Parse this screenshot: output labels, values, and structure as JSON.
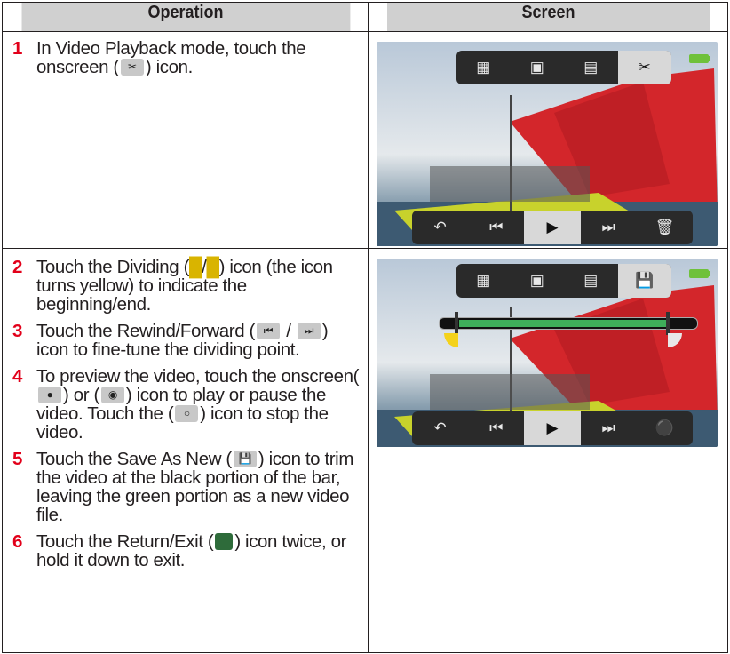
{
  "header": {
    "col1": "Operation",
    "col2": "Screen"
  },
  "steps": [
    {
      "num": "1",
      "parts": [
        "In Video Playback mode, touch the onscreen (",
        ") icon."
      ],
      "icons": [
        "scissors-icon"
      ]
    },
    {
      "num": "2",
      "parts": [
        "Touch the Dividing (",
        "/",
        ") icon (the icon turns yellow) to indicate the beginning/end."
      ],
      "icons": [
        "divider-left-icon",
        "divider-right-icon"
      ]
    },
    {
      "num": "3",
      "parts": [
        "Touch the Rewind/Forward (",
        " / ",
        ") icon to fine-tune the dividing point."
      ],
      "icons": [
        "rewind-icon",
        "forward-icon"
      ]
    },
    {
      "num": "4",
      "parts": [
        "To preview the video, touch the onscreen(",
        ") or (",
        ") icon to play or pause the video. Touch the (",
        ") icon to stop the video."
      ],
      "icons": [
        "play-icon",
        "pause-icon",
        "stop-icon"
      ]
    },
    {
      "num": "5",
      "parts": [
        "Touch the Save As New (",
        ") icon to trim the video at the black portion of the bar, leaving the green portion as a new video file."
      ],
      "icons": [
        "save-icon"
      ]
    },
    {
      "num": "6",
      "parts": [
        "Touch the Return/Exit (",
        ") icon twice, or hold it down to exit."
      ],
      "icons": [
        "return-exit-icon"
      ]
    }
  ],
  "colors": {
    "step_number": "#e2001a",
    "header_bg": "#d0d0d0",
    "trim_bar": "#3fae5a",
    "divider_marker": "#f4d21b",
    "sail": "#d3262b"
  }
}
